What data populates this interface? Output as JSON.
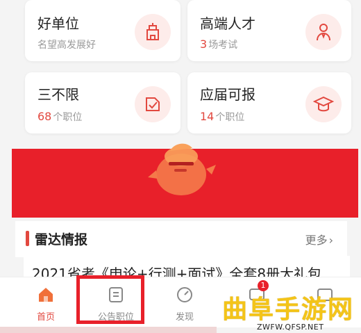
{
  "cards": [
    {
      "title": "好单位",
      "sub_num": "",
      "sub_text": "名望高发展好",
      "icon": "building-icon"
    },
    {
      "title": "高端人才",
      "sub_num": "3",
      "sub_text": "场考试",
      "icon": "person-icon"
    },
    {
      "title": "三不限",
      "sub_num": "68",
      "sub_text": "个职位",
      "icon": "checklist-icon"
    },
    {
      "title": "应届可报",
      "sub_num": "14",
      "sub_text": "个职位",
      "icon": "graduation-cap-icon"
    }
  ],
  "section": {
    "title": "雷达情报",
    "more": "更多"
  },
  "news_headline": "2021省考《申论+行测+面试》全套8册大礼包",
  "tabs": [
    {
      "label": "首页",
      "icon": "home-icon",
      "active": true
    },
    {
      "label": "公告职位",
      "icon": "document-icon",
      "active": false
    },
    {
      "label": "发现",
      "icon": "compass-icon",
      "active": false
    },
    {
      "label": "",
      "icon": "message-icon",
      "badge": "1"
    },
    {
      "label": "",
      "icon": "profile-icon"
    }
  ],
  "watermark": {
    "text": "曲阜手游网",
    "url": "ZWFW.QFSP.NET"
  },
  "colors": {
    "accent": "#e2483f",
    "banner": "#e8202a"
  }
}
